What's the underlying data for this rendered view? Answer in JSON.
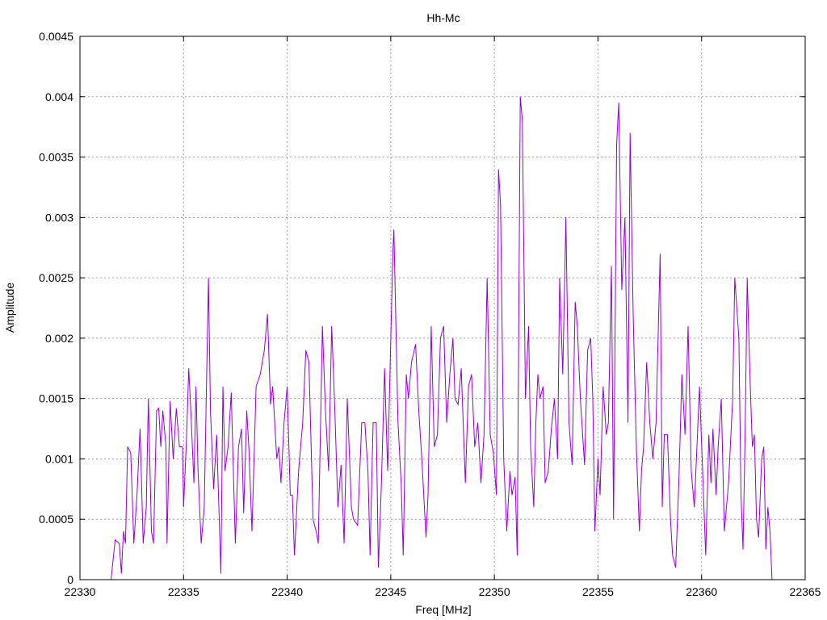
{
  "chart_data": {
    "type": "line",
    "title": "Hh-Mc",
    "xlabel": "Freq [MHz]",
    "ylabel": "Amplitude",
    "xlim": [
      22330,
      22365
    ],
    "ylim": [
      0,
      0.0045
    ],
    "xticks": [
      "22330",
      "22335",
      "22340",
      "22345",
      "22350",
      "22355",
      "22360",
      "22365"
    ],
    "xtick_values": [
      22330,
      22335,
      22340,
      22345,
      22350,
      22355,
      22360,
      22365
    ],
    "yticks": [
      "0",
      "0.0005",
      "0.001",
      "0.0015",
      "0.002",
      "0.0025",
      "0.003",
      "0.0035",
      "0.004",
      "0.0045"
    ],
    "ytick_values": [
      0,
      0.0005,
      0.001,
      0.0015,
      0.002,
      0.0025,
      0.003,
      0.0035,
      0.004,
      0.0045
    ],
    "grid": true,
    "legend": "none",
    "colors": {
      "series": "#9400d3",
      "grid": "#a0a0a0",
      "axis": "#000000"
    },
    "series": [
      {
        "name": "Hh-Mc",
        "x": [
          22331.5,
          22331.7,
          22331.9,
          22332.0,
          22332.1,
          22332.2,
          22332.3,
          22332.45,
          22332.6,
          22332.75,
          22332.9,
          22333.05,
          22333.2,
          22333.3,
          22333.45,
          22333.55,
          22333.7,
          22333.8,
          22333.9,
          22334.0,
          22334.15,
          22334.2,
          22334.35,
          22334.5,
          22334.65,
          22334.8,
          22334.95,
          22335.0,
          22335.15,
          22335.25,
          22335.35,
          22335.5,
          22335.6,
          22335.7,
          22335.85,
          22336.0,
          22336.2,
          22336.3,
          22336.45,
          22336.6,
          22336.8,
          22336.9,
          22337.0,
          22337.15,
          22337.3,
          22337.5,
          22337.65,
          22337.8,
          22337.9,
          22338.05,
          22338.15,
          22338.3,
          22338.5,
          22338.7,
          22338.9,
          22339.05,
          22339.2,
          22339.3,
          22339.5,
          22339.6,
          22339.7,
          22339.85,
          22340.0,
          22340.15,
          22340.25,
          22340.35,
          22340.55,
          22340.75,
          22340.9,
          22341.05,
          22341.25,
          22341.4,
          22341.5,
          22341.7,
          22341.85,
          22342.0,
          22342.15,
          22342.3,
          22342.45,
          22342.6,
          22342.75,
          22342.9,
          22343.1,
          22343.2,
          22343.4,
          22343.6,
          22343.75,
          22343.9,
          22344.0,
          22344.15,
          22344.3,
          22344.4,
          22344.55,
          22344.7,
          22344.85,
          22345.1,
          22345.15,
          22345.35,
          22345.5,
          22345.6,
          22345.75,
          22345.85,
          22346.0,
          22346.2,
          22346.35,
          22346.5,
          22346.7,
          22346.8,
          22346.95,
          22347.1,
          22347.25,
          22347.4,
          22347.55,
          22347.7,
          22347.85,
          22348.0,
          22348.1,
          22348.25,
          22348.4,
          22348.6,
          22348.75,
          22348.9,
          22349.05,
          22349.2,
          22349.35,
          22349.5,
          22349.65,
          22349.8,
          22349.95,
          22350.1,
          22350.2,
          22350.3,
          22350.45,
          22350.6,
          22350.75,
          22350.85,
          22351.0,
          22351.1,
          22351.25,
          22351.35,
          22351.5,
          22351.65,
          22351.75,
          22351.9,
          22352.0,
          22352.1,
          22352.2,
          22352.35,
          22352.45,
          22352.6,
          22352.75,
          22352.9,
          22353.05,
          22353.15,
          22353.3,
          22353.45,
          22353.6,
          22353.75,
          22353.9,
          22354.0,
          22354.15,
          22354.35,
          22354.5,
          22354.65,
          22354.75,
          22354.85,
          22355.0,
          22355.1,
          22355.25,
          22355.4,
          22355.5,
          22355.65,
          22355.75,
          22355.9,
          22356.0,
          22356.15,
          22356.3,
          22356.45,
          22356.55,
          22356.7,
          22356.85,
          22357.0,
          22357.1,
          22357.2,
          22357.35,
          22357.5,
          22357.65,
          22357.8,
          22358.0,
          22358.1,
          22358.2,
          22358.35,
          22358.5,
          22358.6,
          22358.75,
          22358.9,
          22359.05,
          22359.2,
          22359.35,
          22359.5,
          22359.65,
          22359.8,
          22359.9,
          22360.05,
          22360.2,
          22360.35,
          22360.45,
          22360.55,
          22360.7,
          22360.8,
          22360.95,
          22361.1,
          22361.3,
          22361.5,
          22361.6,
          22361.8,
          22361.9,
          22362.0,
          22362.1,
          22362.2,
          22362.35,
          22362.45,
          22362.55,
          22362.65,
          22362.75,
          22362.9,
          22363.0,
          22363.1,
          22363.2,
          22363.3,
          22363.4
        ],
        "y": [
          0,
          0.00033,
          0.0003,
          5e-05,
          0.0004,
          0.0003,
          0.0011,
          0.00105,
          0.0003,
          0.0007,
          0.00125,
          0.0003,
          0.0006,
          0.0015,
          0.0004,
          0.0003,
          0.0014,
          0.00142,
          0.0011,
          0.0014,
          0.0011,
          0.0003,
          0.00148,
          0.001,
          0.00142,
          0.0011,
          0.0011,
          0.0006,
          0.0012,
          0.00175,
          0.0014,
          0.0008,
          0.0016,
          0.0009,
          0.0003,
          0.0006,
          0.0025,
          0.0014,
          0.00075,
          0.0012,
          5e-05,
          0.0016,
          0.0009,
          0.0011,
          0.00155,
          0.0003,
          0.0011,
          0.00125,
          0.00055,
          0.0014,
          0.0011,
          0.0004,
          0.0016,
          0.0017,
          0.0019,
          0.0022,
          0.00145,
          0.0016,
          0.001,
          0.0011,
          0.0008,
          0.0013,
          0.0016,
          0.0007,
          0.0007,
          0.0002,
          0.0009,
          0.0013,
          0.0019,
          0.0018,
          0.0005,
          0.0004,
          0.0003,
          0.0021,
          0.0014,
          0.0009,
          0.0021,
          0.0014,
          0.0006,
          0.00095,
          0.0003,
          0.0015,
          0.0006,
          0.0005,
          0.00045,
          0.0013,
          0.0013,
          0.0009,
          0.0002,
          0.0013,
          0.0013,
          0.0001,
          0.0008,
          0.00175,
          0.0009,
          0.0027,
          0.0029,
          0.0013,
          0.0008,
          0.0002,
          0.0017,
          0.0015,
          0.0018,
          0.00195,
          0.0014,
          0.001,
          0.00035,
          0.0007,
          0.0021,
          0.0011,
          0.0012,
          0.002,
          0.0021,
          0.0013,
          0.0017,
          0.002,
          0.0015,
          0.00145,
          0.00175,
          0.0008,
          0.0016,
          0.0017,
          0.0011,
          0.0013,
          0.0008,
          0.0012,
          0.0025,
          0.0012,
          0.00105,
          0.0007,
          0.0034,
          0.0031,
          0.001,
          0.0004,
          0.0009,
          0.0007,
          0.00085,
          0.0002,
          0.004,
          0.0038,
          0.0015,
          0.0021,
          0.0011,
          0.0006,
          0.0013,
          0.0017,
          0.0015,
          0.0016,
          0.0008,
          0.0009,
          0.00125,
          0.0015,
          0.001,
          0.0025,
          0.0017,
          0.003,
          0.0013,
          0.00095,
          0.0023,
          0.0021,
          0.0015,
          0.00095,
          0.0019,
          0.002,
          0.0015,
          0.0004,
          0.001,
          0.0007,
          0.0016,
          0.0012,
          0.0013,
          0.0026,
          0.0005,
          0.0036,
          0.00395,
          0.0024,
          0.003,
          0.0013,
          0.0037,
          0.0022,
          0.0011,
          0.0004,
          0.0009,
          0.0011,
          0.0018,
          0.0013,
          0.001,
          0.0013,
          0.0027,
          0.0006,
          0.0012,
          0.0012,
          0.0005,
          0.0002,
          0.0001,
          0.0008,
          0.0017,
          0.0012,
          0.0021,
          0.0009,
          0.0006,
          0.0012,
          0.0016,
          0.0009,
          0.0002,
          0.0012,
          0.0008,
          0.00125,
          0.0007,
          0.0011,
          0.0015,
          0.0004,
          0.0008,
          0.0015,
          0.0025,
          0.002,
          0.0007,
          0.00025,
          0.0012,
          0.0025,
          0.0016,
          0.0011,
          0.0012,
          0.0005,
          0.00035,
          0.001,
          0.0011,
          0.00025,
          0.0006,
          0.0004,
          0
        ]
      }
    ]
  }
}
